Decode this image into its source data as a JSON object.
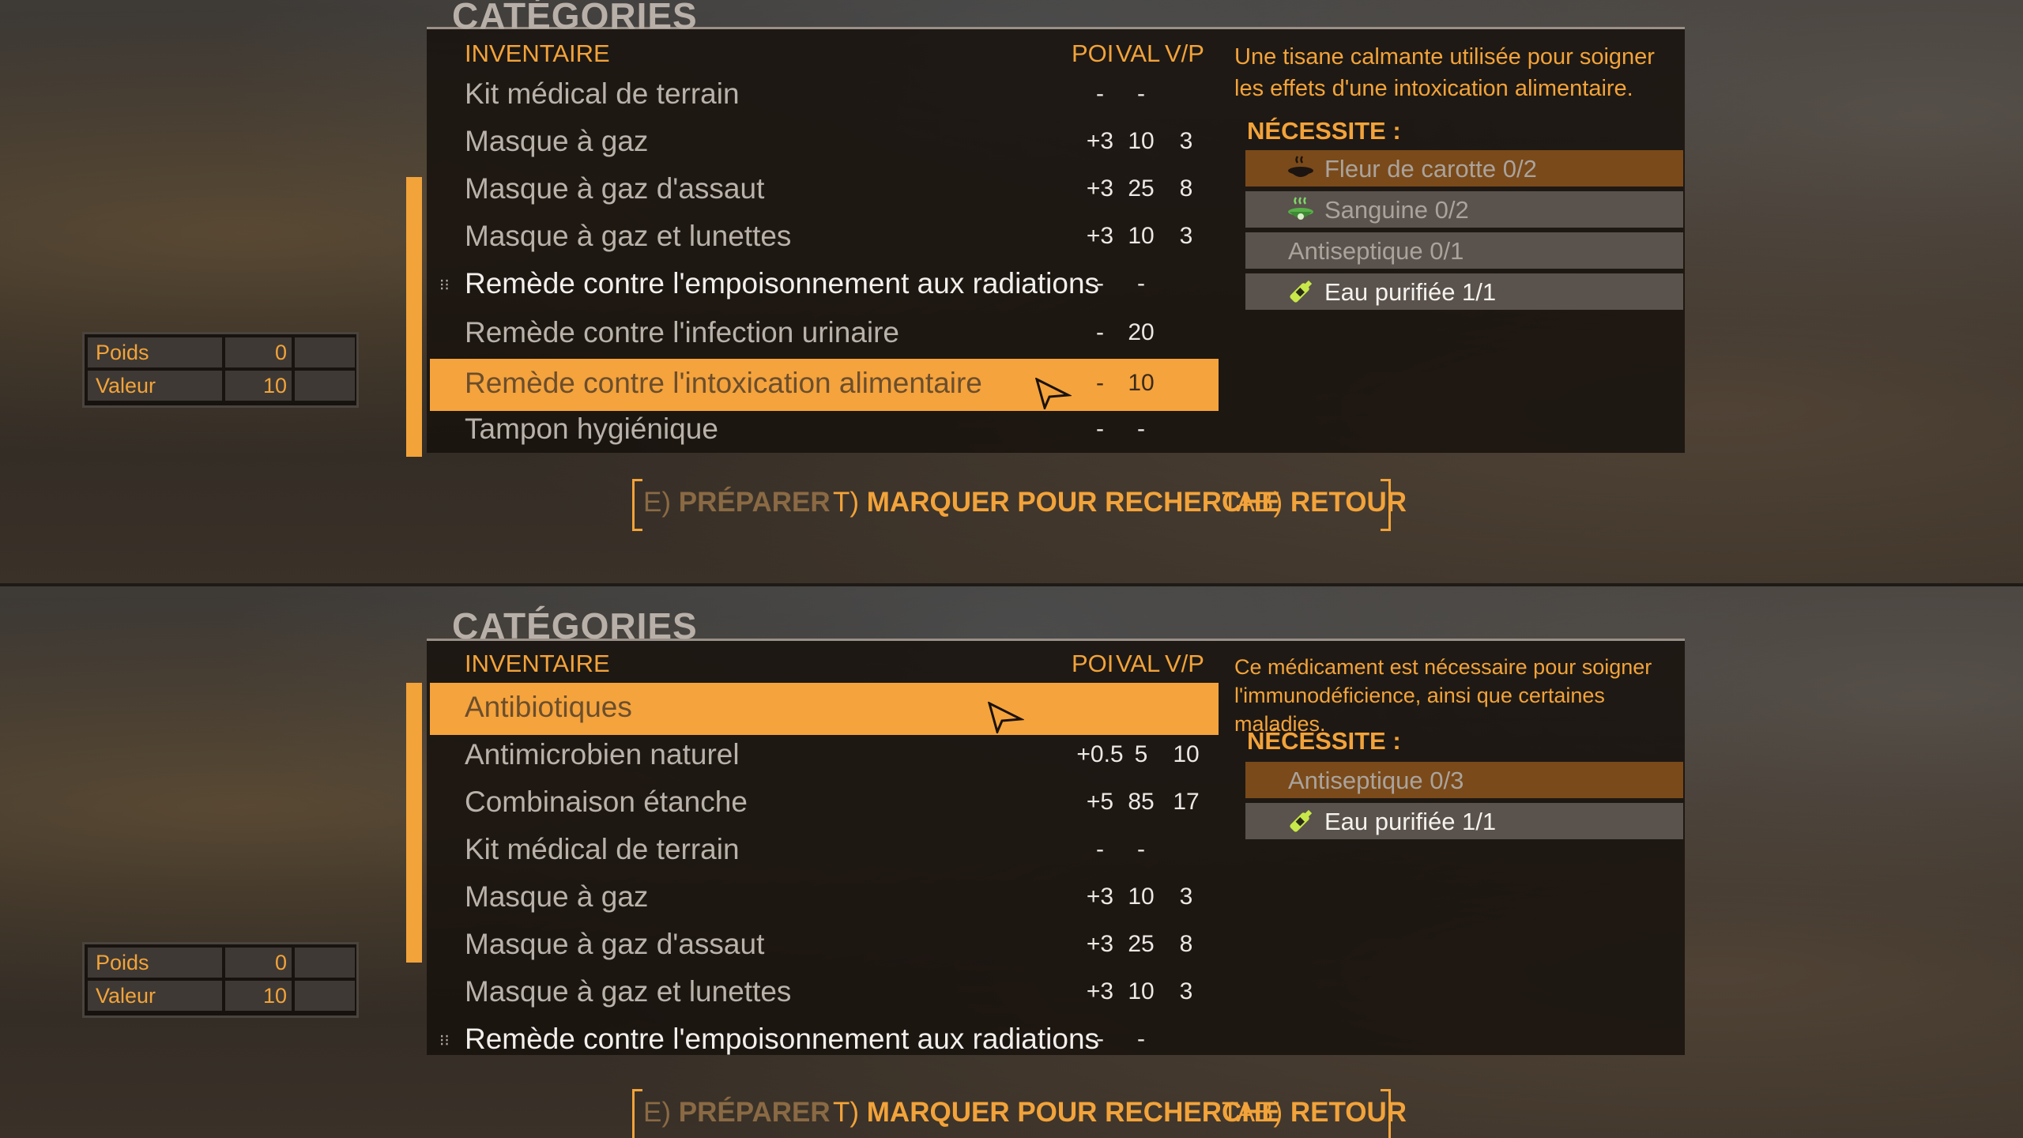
{
  "colors": {
    "accent": "#f2a33a",
    "selected_row": "#f5a33d",
    "panel_bg": "#18120e"
  },
  "top": {
    "category_title": "CATÉGORIES",
    "list_header": "INVENTAIRE",
    "columns": {
      "poi": "POI",
      "val": "VAL",
      "vp": "V/P"
    },
    "items": [
      {
        "name": "Kit médical de terrain",
        "poi": "-",
        "val": "-",
        "vp": ""
      },
      {
        "name": "Masque à gaz",
        "poi": "+3",
        "val": "10",
        "vp": "3"
      },
      {
        "name": "Masque à gaz d'assaut",
        "poi": "+3",
        "val": "25",
        "vp": "8"
      },
      {
        "name": "Masque à gaz et lunettes",
        "poi": "+3",
        "val": "10",
        "vp": "3"
      },
      {
        "name": "Remède contre l'empoisonnement aux radiations",
        "poi": "-",
        "val": "-",
        "vp": ""
      },
      {
        "name": "Remède contre l'infection urinaire",
        "poi": "-",
        "val": "20",
        "vp": ""
      },
      {
        "name": "Remède contre l'intoxication alimentaire",
        "poi": "-",
        "val": "10",
        "vp": ""
      },
      {
        "name": "Tampon hygiénique",
        "poi": "-",
        "val": "-",
        "vp": ""
      }
    ],
    "description": "Une tisane calmante utilisée pour soigner les effets d'une intoxication alimentaire.",
    "requires_label": "NÉCESSITE :",
    "requirements": [
      {
        "text": "Fleur de carotte 0/2",
        "icon": "cooking-pot-icon"
      },
      {
        "text": "Sanguine 0/2",
        "icon": "herb-bowl-icon"
      },
      {
        "text": "Antiseptique 0/1",
        "icon": ""
      },
      {
        "text": "Eau purifiée 1/1",
        "icon": "water-bottle-icon"
      }
    ],
    "stats": {
      "weight_label": "Poids",
      "weight_value": "0",
      "value_label": "Valeur",
      "value_value": "10"
    },
    "actions": {
      "prepare_key": "E)",
      "prepare_label": "PRÉPARER",
      "mark_key": "T)",
      "mark_label": "MARQUER POUR RECHERCHE",
      "back_key": "TAB)",
      "back_label": "RETOUR"
    }
  },
  "bottom": {
    "category_title": "CATÉGORIES",
    "list_header": "INVENTAIRE",
    "columns": {
      "poi": "POI",
      "val": "VAL",
      "vp": "V/P"
    },
    "items": [
      {
        "name": "Antibiotiques",
        "poi": "",
        "val": "",
        "vp": ""
      },
      {
        "name": "Antimicrobien naturel",
        "poi": "+0.5",
        "val": "5",
        "vp": "10"
      },
      {
        "name": "Combinaison étanche",
        "poi": "+5",
        "val": "85",
        "vp": "17"
      },
      {
        "name": "Kit médical de terrain",
        "poi": "-",
        "val": "-",
        "vp": ""
      },
      {
        "name": "Masque à gaz",
        "poi": "+3",
        "val": "10",
        "vp": "3"
      },
      {
        "name": "Masque à gaz d'assaut",
        "poi": "+3",
        "val": "25",
        "vp": "8"
      },
      {
        "name": "Masque à gaz et lunettes",
        "poi": "+3",
        "val": "10",
        "vp": "3"
      },
      {
        "name": "Remède contre l'empoisonnement aux radiations",
        "poi": "-",
        "val": "-",
        "vp": ""
      }
    ],
    "description": "Ce médicament est nécessaire pour soigner l'immunodéficience, ainsi que certaines maladies.",
    "requires_label": "NÉCESSITE :",
    "requirements": [
      {
        "text": "Antiseptique 0/3",
        "icon": ""
      },
      {
        "text": "Eau purifiée 1/1",
        "icon": "water-bottle-icon"
      }
    ],
    "stats": {
      "weight_label": "Poids",
      "weight_value": "0",
      "value_label": "Valeur",
      "value_value": "10"
    },
    "actions": {
      "prepare_key": "E)",
      "prepare_label": "PRÉPARER",
      "mark_key": "T)",
      "mark_label": "MARQUER POUR RECHERCHE",
      "back_key": "TAB)",
      "back_label": "RETOUR"
    }
  }
}
